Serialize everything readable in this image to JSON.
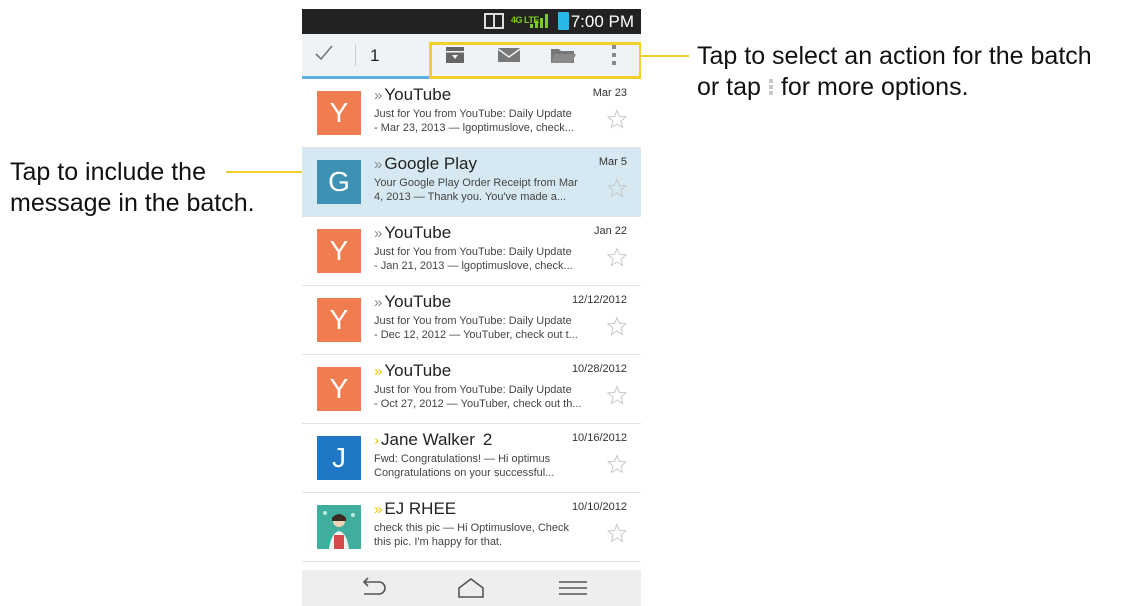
{
  "status_bar": {
    "network": "4G LTE",
    "time": "7:00 PM"
  },
  "action_bar": {
    "selected_count": "1",
    "icons": [
      "check-icon",
      "archive-icon",
      "mark-unread-icon",
      "move-to-folder-icon",
      "overflow-menu-icon"
    ]
  },
  "messages": [
    {
      "avatar": "Y",
      "avatar_color": "#f07d4f",
      "sender": "YouTube",
      "thread_count": "",
      "date": "Mar 23",
      "snippet1": "Just for You from YouTube: Daily Update",
      "snippet2": "- Mar 23, 2013 — lgoptimuslove, check...",
      "important": false
    },
    {
      "avatar": "G",
      "avatar_color": "#3f91b3",
      "sender": "Google Play",
      "thread_count": "",
      "date": "Mar 5",
      "snippet1": "Your Google Play Order Receipt from Mar",
      "snippet2": "4, 2013 — Thank you. You've made a...",
      "important": false
    },
    {
      "avatar": "Y",
      "avatar_color": "#f07d4f",
      "sender": "YouTube",
      "thread_count": "",
      "date": "Jan 22",
      "snippet1": "Just for You from YouTube: Daily Update",
      "snippet2": "- Jan 21, 2013 — lgoptimuslove, check...",
      "important": false
    },
    {
      "avatar": "Y",
      "avatar_color": "#f07d4f",
      "sender": "YouTube",
      "thread_count": "",
      "date": "12/12/2012",
      "snippet1": "Just for You from YouTube: Daily Update",
      "snippet2": "- Dec 12, 2012 — YouTuber, check out t...",
      "important": false
    },
    {
      "avatar": "Y",
      "avatar_color": "#f07d4f",
      "sender": "YouTube",
      "thread_count": "",
      "date": "10/28/2012",
      "snippet1": "Just for You from YouTube: Daily Update",
      "snippet2": "- Oct 27, 2012 — YouTuber, check out th...",
      "important": true
    },
    {
      "avatar": "J",
      "avatar_color": "#1f77c5",
      "sender": "Jane Walker",
      "thread_count": "2",
      "date": "10/16/2012",
      "snippet1": "Fwd: Congratulations! — Hi optimus",
      "snippet2": "Congratulations on your successful...",
      "important": true
    },
    {
      "avatar": "",
      "avatar_color": "#3fae9d",
      "sender": "EJ RHEE",
      "thread_count": "",
      "date": "10/10/2012",
      "snippet1": "check this pic — Hi Optimuslove, Check",
      "snippet2": "this pic. I'm happy for that.",
      "important": true
    }
  ],
  "callouts": {
    "right_line1": "Tap to select an action for the batch",
    "right_line2_a": "or tap",
    "right_line2_b": "for more options.",
    "left_line1": "Tap to include the",
    "left_line2": "message in the batch."
  },
  "nav_bar": {
    "icons": [
      "back-icon",
      "home-icon",
      "menu-icon"
    ]
  },
  "colors": {
    "callout_yellow": "#f2cf29",
    "selected_row": "#d6e9f2",
    "action_bar_line": "#58b0e0"
  }
}
